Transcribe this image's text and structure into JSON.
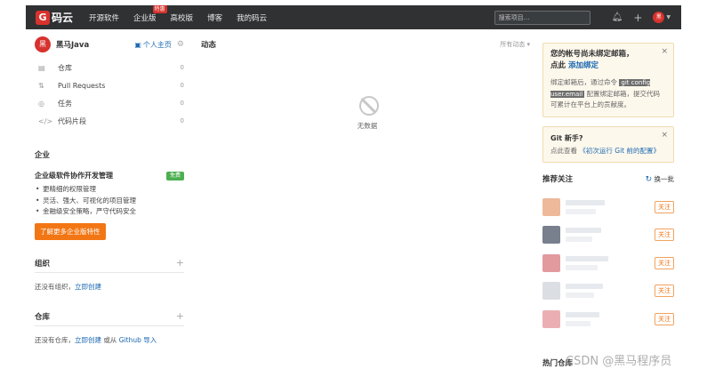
{
  "nav": {
    "logo_mark": "G",
    "logo_text": "码云",
    "items": [
      "开源软件",
      "企业版",
      "高校版",
      "博客",
      "我的码云"
    ],
    "special_badge": "特惠",
    "search_placeholder": "搜索项目…",
    "avatar_text": "黑"
  },
  "user": {
    "avatar_text": "黑",
    "name": "黑马Java",
    "homepage_label": "个人主页"
  },
  "menu": [
    {
      "label": "仓库",
      "count": "0"
    },
    {
      "label": "Pull Requests",
      "count": "0"
    },
    {
      "label": "任务",
      "count": "0"
    },
    {
      "label": "代码片段",
      "count": "0"
    }
  ],
  "enterprise": {
    "title": "企业",
    "box_title": "企业级软件协作开发管理",
    "free_badge": "免费",
    "bullets": [
      "更精细的权限管理",
      "灵活、强大、可视化的项目管理",
      "金融级安全策略，严守代码安全"
    ],
    "cta": "了解更多企业版特性"
  },
  "org": {
    "title": "组织",
    "text": "还没有组织，",
    "link": "立即创建"
  },
  "repo": {
    "title": "仓库",
    "text_before": "还没有仓库，",
    "link_create": "立即创建",
    "text_mid": " 或从 ",
    "link_github": "Github 导入"
  },
  "feed": {
    "title": "动态",
    "filter": "所有动态",
    "empty_text": "无数据"
  },
  "email_notice": {
    "title_line1": "您的帐号尚未绑定邮箱，",
    "title_line2_prefix": "点此 ",
    "title_link": "添加绑定",
    "body_before": "绑定邮箱后，通过命令",
    "code": "git config user.email",
    "body_after": "配置绑定邮箱，提交代码可累计在平台上的贡献度。"
  },
  "git_notice": {
    "title": "Git 新手?",
    "body_before": "点此查看 ",
    "link": "《初次运行 Git 前的配置》"
  },
  "recommend": {
    "title": "推荐关注",
    "refresh": "换一批",
    "follow_label": "关注",
    "items": [
      {
        "color": "#e8a07a"
      },
      {
        "color": "#4a5565"
      },
      {
        "color": "#d9787f"
      },
      {
        "color": "#cfd3d8"
      },
      {
        "color": "#e4949a"
      }
    ]
  },
  "bottom_label": "热门仓库",
  "watermark": "CSDN @黑马程序员"
}
